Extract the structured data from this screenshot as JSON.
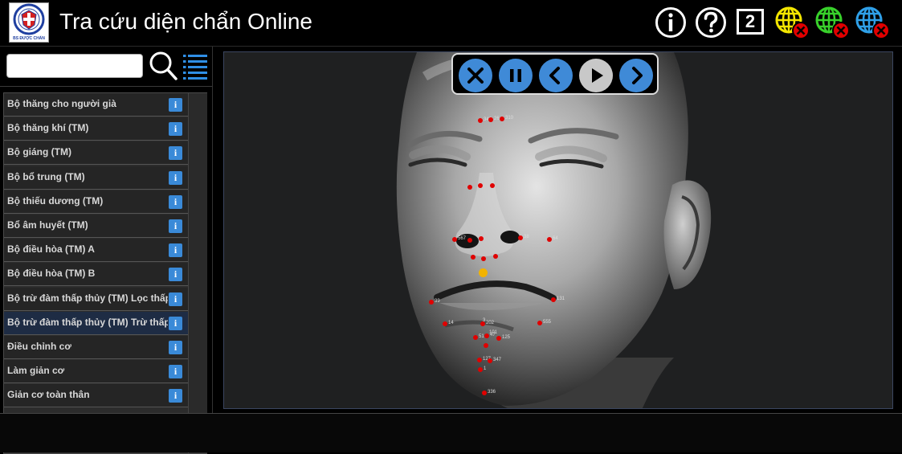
{
  "app": {
    "title": "Tra cứu diện chẩn Online",
    "logo_caption": "BS ĐƯỢC CHẨN"
  },
  "header": {
    "info_icon": "info-circle-icon",
    "help_icon": "question-circle-icon",
    "count_badge": "2",
    "globe_icons": [
      {
        "name": "globe-yellow-icon",
        "color": "#f3e600"
      },
      {
        "name": "globe-green-icon",
        "color": "#38d12b"
      },
      {
        "name": "globe-blue-icon",
        "color": "#2fa0e8"
      }
    ],
    "error_color": "#e00000"
  },
  "search": {
    "value": "",
    "placeholder": ""
  },
  "list": {
    "info_label": "i",
    "active_index": 9,
    "items": [
      {
        "label": "Bộ thăng cho người già"
      },
      {
        "label": "Bộ thăng khí (TM)"
      },
      {
        "label": "Bộ giáng (TM)"
      },
      {
        "label": "Bộ bổ trung (TM)"
      },
      {
        "label": "Bộ thiếu dương (TM)"
      },
      {
        "label": "Bổ âm huyết (TM)"
      },
      {
        "label": "Bộ điều hòa (TM) A"
      },
      {
        "label": "Bộ điều hòa (TM) B"
      },
      {
        "label": "Bộ trừ đàm thấp thủy (TM) Lọc thấp"
      },
      {
        "label": "Bộ trừ đàm thấp thủy (TM) Trừ thấp"
      },
      {
        "label": "Điều chỉnh cơ"
      },
      {
        "label": "Làm giản cơ"
      },
      {
        "label": "Giản cơ toàn thân"
      }
    ]
  },
  "player": {
    "buttons": [
      {
        "name": "close-icon"
      },
      {
        "name": "pause-icon"
      },
      {
        "name": "previous-icon"
      },
      {
        "name": "play-icon"
      },
      {
        "name": "next-icon"
      }
    ],
    "accent": "#3f8ad7"
  },
  "face_points": {
    "labels": [
      "340",
      "26",
      "310",
      "567",
      "38",
      "64",
      "39",
      "131",
      "14",
      "555",
      "202",
      "51",
      "47",
      "125",
      "127",
      "347",
      "1",
      "336",
      "3",
      "101"
    ],
    "point_color": "#e00000",
    "highlight_color": "#f2b300"
  }
}
